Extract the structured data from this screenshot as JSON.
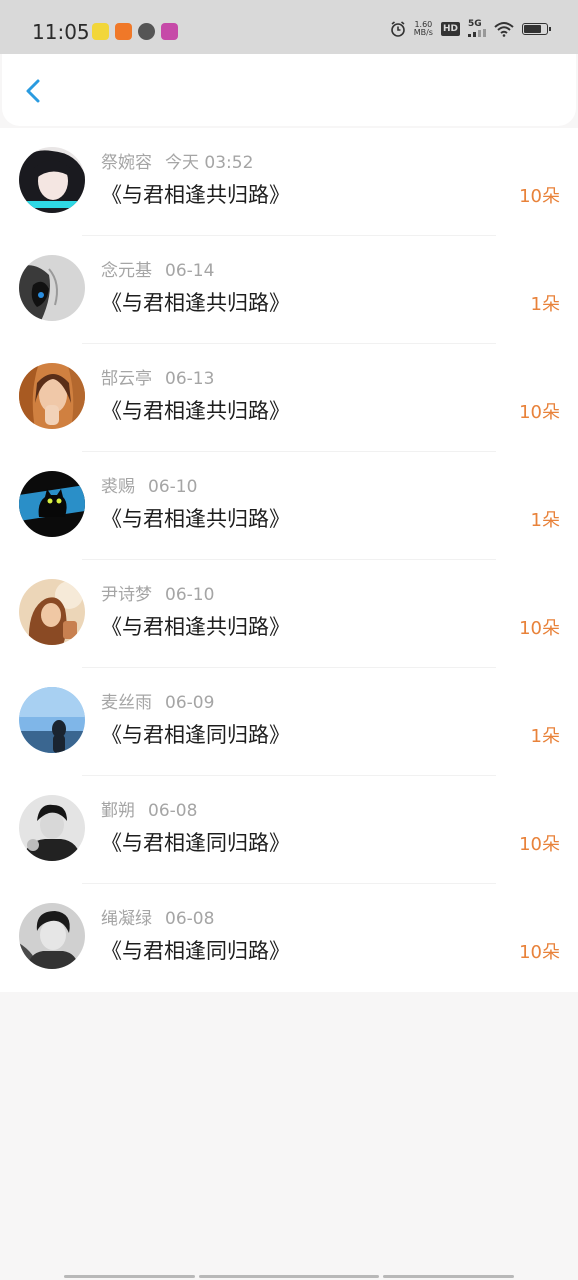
{
  "status_bar": {
    "time": "11:05",
    "net_speed_value": "1.60",
    "net_speed_unit": "MB/s",
    "hd_label": "HD",
    "signal_label": "5G",
    "notif_colors": [
      "#f2d63a",
      "#f07828",
      "#555555",
      "#c64aa8"
    ]
  },
  "header": {
    "back_icon": "chevron-left-icon",
    "accent_color": "#2a9be0"
  },
  "accent": {
    "amount_color": "#e8823a"
  },
  "records": [
    {
      "name": "祭婉容",
      "date": "今天 03:52",
      "title": "《与君相逢共归路》",
      "amount": "10朵"
    },
    {
      "name": "念元基",
      "date": "06-14",
      "title": "《与君相逢共归路》",
      "amount": "1朵"
    },
    {
      "name": "郜云亭",
      "date": "06-13",
      "title": "《与君相逢共归路》",
      "amount": "10朵"
    },
    {
      "name": "裘赐",
      "date": "06-10",
      "title": "《与君相逢共归路》",
      "amount": "1朵"
    },
    {
      "name": "尹诗梦",
      "date": "06-10",
      "title": "《与君相逢共归路》",
      "amount": "10朵"
    },
    {
      "name": "麦丝雨",
      "date": "06-09",
      "title": "《与君相逢同归路》",
      "amount": "1朵"
    },
    {
      "name": "鄞朔",
      "date": "06-08",
      "title": "《与君相逢同归路》",
      "amount": "10朵"
    },
    {
      "name": "绳凝绿",
      "date": "06-08",
      "title": "《与君相逢同归路》",
      "amount": "10朵"
    }
  ]
}
